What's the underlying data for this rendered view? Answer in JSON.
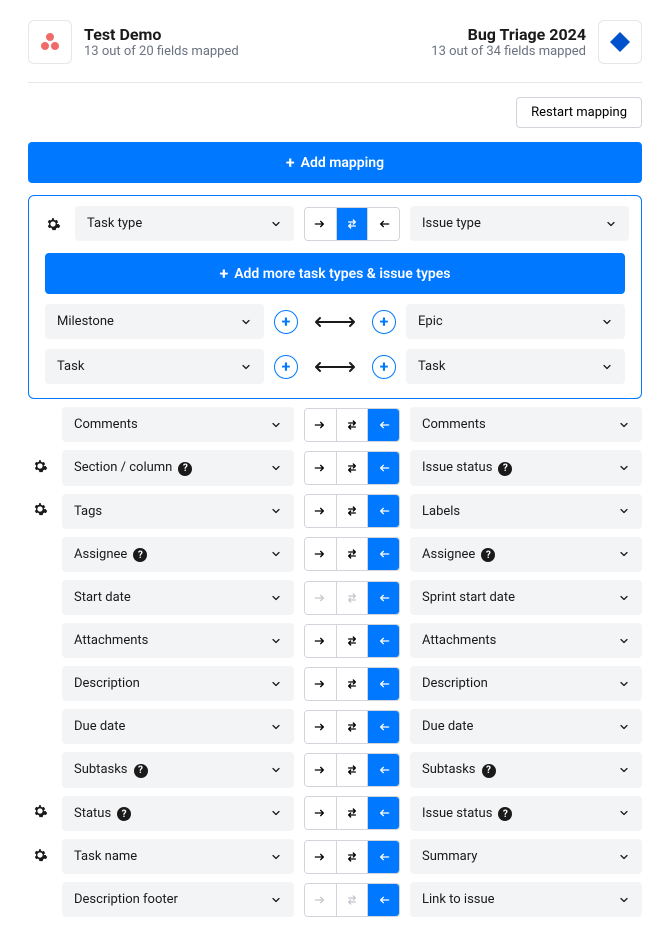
{
  "header": {
    "left_title": "Test Demo",
    "left_sub": "13 out of 20 fields mapped",
    "right_title": "Bug Triage 2024",
    "right_sub": "13 out of 34 fields mapped",
    "left_icon_color": "#f06a6a",
    "right_icon_color": "#0052cc"
  },
  "buttons": {
    "restart": "Restart mapping",
    "add_mapping": "Add mapping",
    "add_more_types": "Add more task types & issue types"
  },
  "expanded": {
    "left_label": "Task type",
    "right_label": "Issue type",
    "active_dir": "both",
    "subs": [
      {
        "left": "Milestone",
        "right": "Epic"
      },
      {
        "left": "Task",
        "right": "Task"
      }
    ]
  },
  "rows": [
    {
      "gear": false,
      "left": "Comments",
      "left_info": false,
      "right": "Comments",
      "right_info": false,
      "active": "left",
      "disabled": []
    },
    {
      "gear": true,
      "left": "Section / column",
      "left_info": true,
      "right": "Issue status",
      "right_info": true,
      "active": "left",
      "disabled": []
    },
    {
      "gear": true,
      "left": "Tags",
      "left_info": false,
      "right": "Labels",
      "right_info": false,
      "active": "left",
      "disabled": []
    },
    {
      "gear": false,
      "left": "Assignee",
      "left_info": true,
      "right": "Assignee",
      "right_info": true,
      "active": "left",
      "disabled": []
    },
    {
      "gear": false,
      "left": "Start date",
      "left_info": false,
      "right": "Sprint start date",
      "right_info": false,
      "active": "left",
      "disabled": [
        "right",
        "both"
      ]
    },
    {
      "gear": false,
      "left": "Attachments",
      "left_info": false,
      "right": "Attachments",
      "right_info": false,
      "active": "left",
      "disabled": []
    },
    {
      "gear": false,
      "left": "Description",
      "left_info": false,
      "right": "Description",
      "right_info": false,
      "active": "left",
      "disabled": []
    },
    {
      "gear": false,
      "left": "Due date",
      "left_info": false,
      "right": "Due date",
      "right_info": false,
      "active": "left",
      "disabled": []
    },
    {
      "gear": false,
      "left": "Subtasks",
      "left_info": true,
      "right": "Subtasks",
      "right_info": true,
      "active": "left",
      "disabled": []
    },
    {
      "gear": true,
      "left": "Status",
      "left_info": true,
      "right": "Issue status",
      "right_info": true,
      "active": "left",
      "disabled": []
    },
    {
      "gear": true,
      "left": "Task name",
      "left_info": false,
      "right": "Summary",
      "right_info": false,
      "active": "left",
      "disabled": []
    },
    {
      "gear": false,
      "left": "Description footer",
      "left_info": false,
      "right": "Link to issue",
      "right_info": false,
      "active": "left",
      "disabled": [
        "right",
        "both"
      ]
    }
  ]
}
